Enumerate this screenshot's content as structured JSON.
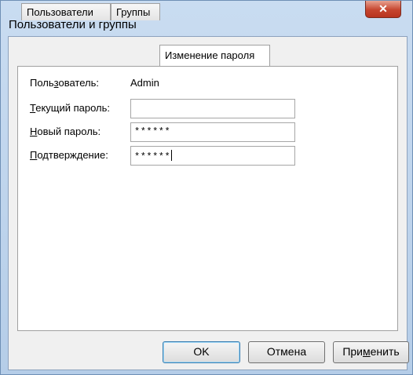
{
  "window": {
    "title": "Пользователи и группы"
  },
  "tabs": [
    {
      "label": "Пользователи",
      "active": false
    },
    {
      "label": "Группы",
      "active": false
    },
    {
      "label": "Изменение пароля",
      "active": true
    }
  ],
  "form": {
    "user": {
      "label_pre": "Поль",
      "label_mnemonic": "з",
      "label_post": "ователь:",
      "value": "Admin"
    },
    "current": {
      "label_mnemonic": "Т",
      "label_post": "екущий пароль:",
      "value": ""
    },
    "new": {
      "label_mnemonic": "Н",
      "label_post": "овый пароль:",
      "value": "******"
    },
    "confirm": {
      "label_mnemonic": "П",
      "label_post": "одтверждение:",
      "value": "******"
    }
  },
  "buttons": {
    "ok": "OK",
    "cancel": "Отмена",
    "apply_pre": "При",
    "apply_mnemonic": "м",
    "apply_post": "енить"
  },
  "colors": {
    "close_button": "#c6452f",
    "frame": "#b5cde8"
  }
}
